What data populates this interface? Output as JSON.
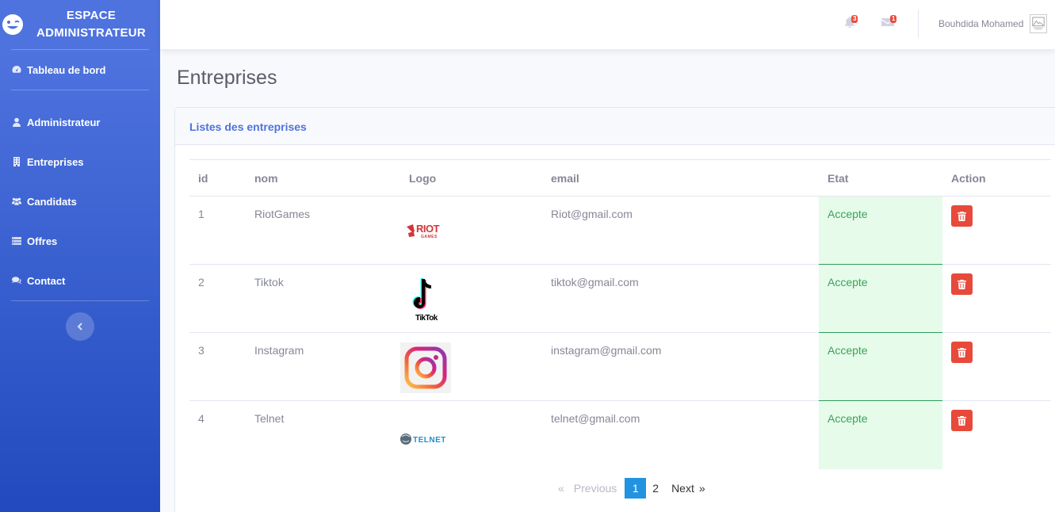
{
  "brand": {
    "line1": "ESPACE",
    "line2": "ADMINISTRATEUR"
  },
  "sidebar": {
    "items": [
      {
        "label": "Tableau de bord",
        "icon": "dashboard-icon"
      },
      {
        "label": "Administrateur",
        "icon": "user-icon"
      },
      {
        "label": "Entreprises",
        "icon": "building-icon"
      },
      {
        "label": "Candidats",
        "icon": "users-icon"
      },
      {
        "label": "Offres",
        "icon": "list-icon"
      },
      {
        "label": "Contact",
        "icon": "comments-icon"
      }
    ]
  },
  "topbar": {
    "alerts_count": "3",
    "messages_count": "1",
    "user_name": "Bouhdida Mohamed"
  },
  "page": {
    "title": "Entreprises"
  },
  "card": {
    "title": "Listes des entreprises"
  },
  "table": {
    "headers": [
      "id",
      "nom",
      "Logo",
      "email",
      "Etat",
      "Action"
    ],
    "rows": [
      {
        "id": "1",
        "nom": "RiotGames",
        "logo": "riot-games-logo",
        "email": "Riot@gmail.com",
        "etat": "Accepte"
      },
      {
        "id": "2",
        "nom": "Tiktok",
        "logo": "tiktok-logo",
        "email": "tiktok@gmail.com",
        "etat": "Accepte"
      },
      {
        "id": "3",
        "nom": "Instagram",
        "logo": "instagram-logo",
        "email": "instagram@gmail.com",
        "etat": "Accepte"
      },
      {
        "id": "4",
        "nom": "Telnet",
        "logo": "telnet-logo",
        "email": "telnet@gmail.com",
        "etat": "Accepte"
      }
    ]
  },
  "pagination": {
    "first": "«",
    "previous": "Previous",
    "pages": [
      "1",
      "2"
    ],
    "active": "1",
    "next": "Next",
    "last": "»"
  },
  "colors": {
    "primary": "#4e73df",
    "danger": "#e74a3b",
    "success_bg": "#e6fbea",
    "active_page": "#2293e0"
  }
}
